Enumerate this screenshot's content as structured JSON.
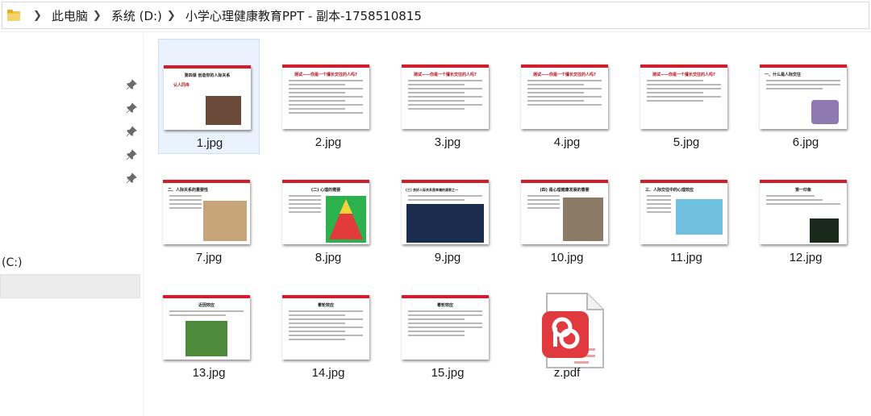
{
  "address_bar": {
    "crumbs": [
      "此电脑",
      "系统 (D:)",
      "小学心理健康教育PPT - 副本-1758510815"
    ]
  },
  "nav": {
    "drive_label": "(C:)",
    "pinned_count": 5
  },
  "files": [
    {
      "name": "1.jpg",
      "slide_title": "第四课 创造你的人际关系",
      "picture": "hands-rose"
    },
    {
      "name": "2.jpg",
      "slide_title": "测试——你是一个擅长交往的人吗?",
      "picture": ""
    },
    {
      "name": "3.jpg",
      "slide_title": "测试——你是一个擅长交往的人吗?",
      "picture": ""
    },
    {
      "name": "4.jpg",
      "slide_title": "测试——你是一个擅长交往的人吗?",
      "picture": ""
    },
    {
      "name": "5.jpg",
      "slide_title": "测试——你是一个擅长交往的人吗?",
      "picture": ""
    },
    {
      "name": "6.jpg",
      "slide_title": "一、什么是人际交往",
      "picture": "ball"
    },
    {
      "name": "7.jpg",
      "slide_title": "二、人际关系的重要性",
      "picture": "family"
    },
    {
      "name": "8.jpg",
      "slide_title": "(二) 心理的需要",
      "picture": "pyramid"
    },
    {
      "name": "9.jpg",
      "slide_title": "(三) 良好人际关系是幸福的源泉之一",
      "picture": "city-night"
    },
    {
      "name": "10.jpg",
      "slide_title": "(四) 是心理健康发展的需要",
      "picture": "portrait"
    },
    {
      "name": "11.jpg",
      "slide_title": "三、人际交往中的心理效应",
      "picture": "child-bubbles"
    },
    {
      "name": "12.jpg",
      "slide_title": "第一印象",
      "picture": "cartoon"
    },
    {
      "name": "13.jpg",
      "slide_title": "近因效应",
      "picture": "kids-circle"
    },
    {
      "name": "14.jpg",
      "slide_title": "晕轮效应",
      "picture": ""
    },
    {
      "name": "15.jpg",
      "slide_title": "晕轮效应",
      "picture": ""
    },
    {
      "name": "z.pdf",
      "slide_title": "",
      "picture": "pdf-icon"
    }
  ],
  "colors": {
    "slide_accent": "#d21e2b",
    "selection_bg": "#eaf3fd",
    "pdf_red": "#e03a3f"
  }
}
